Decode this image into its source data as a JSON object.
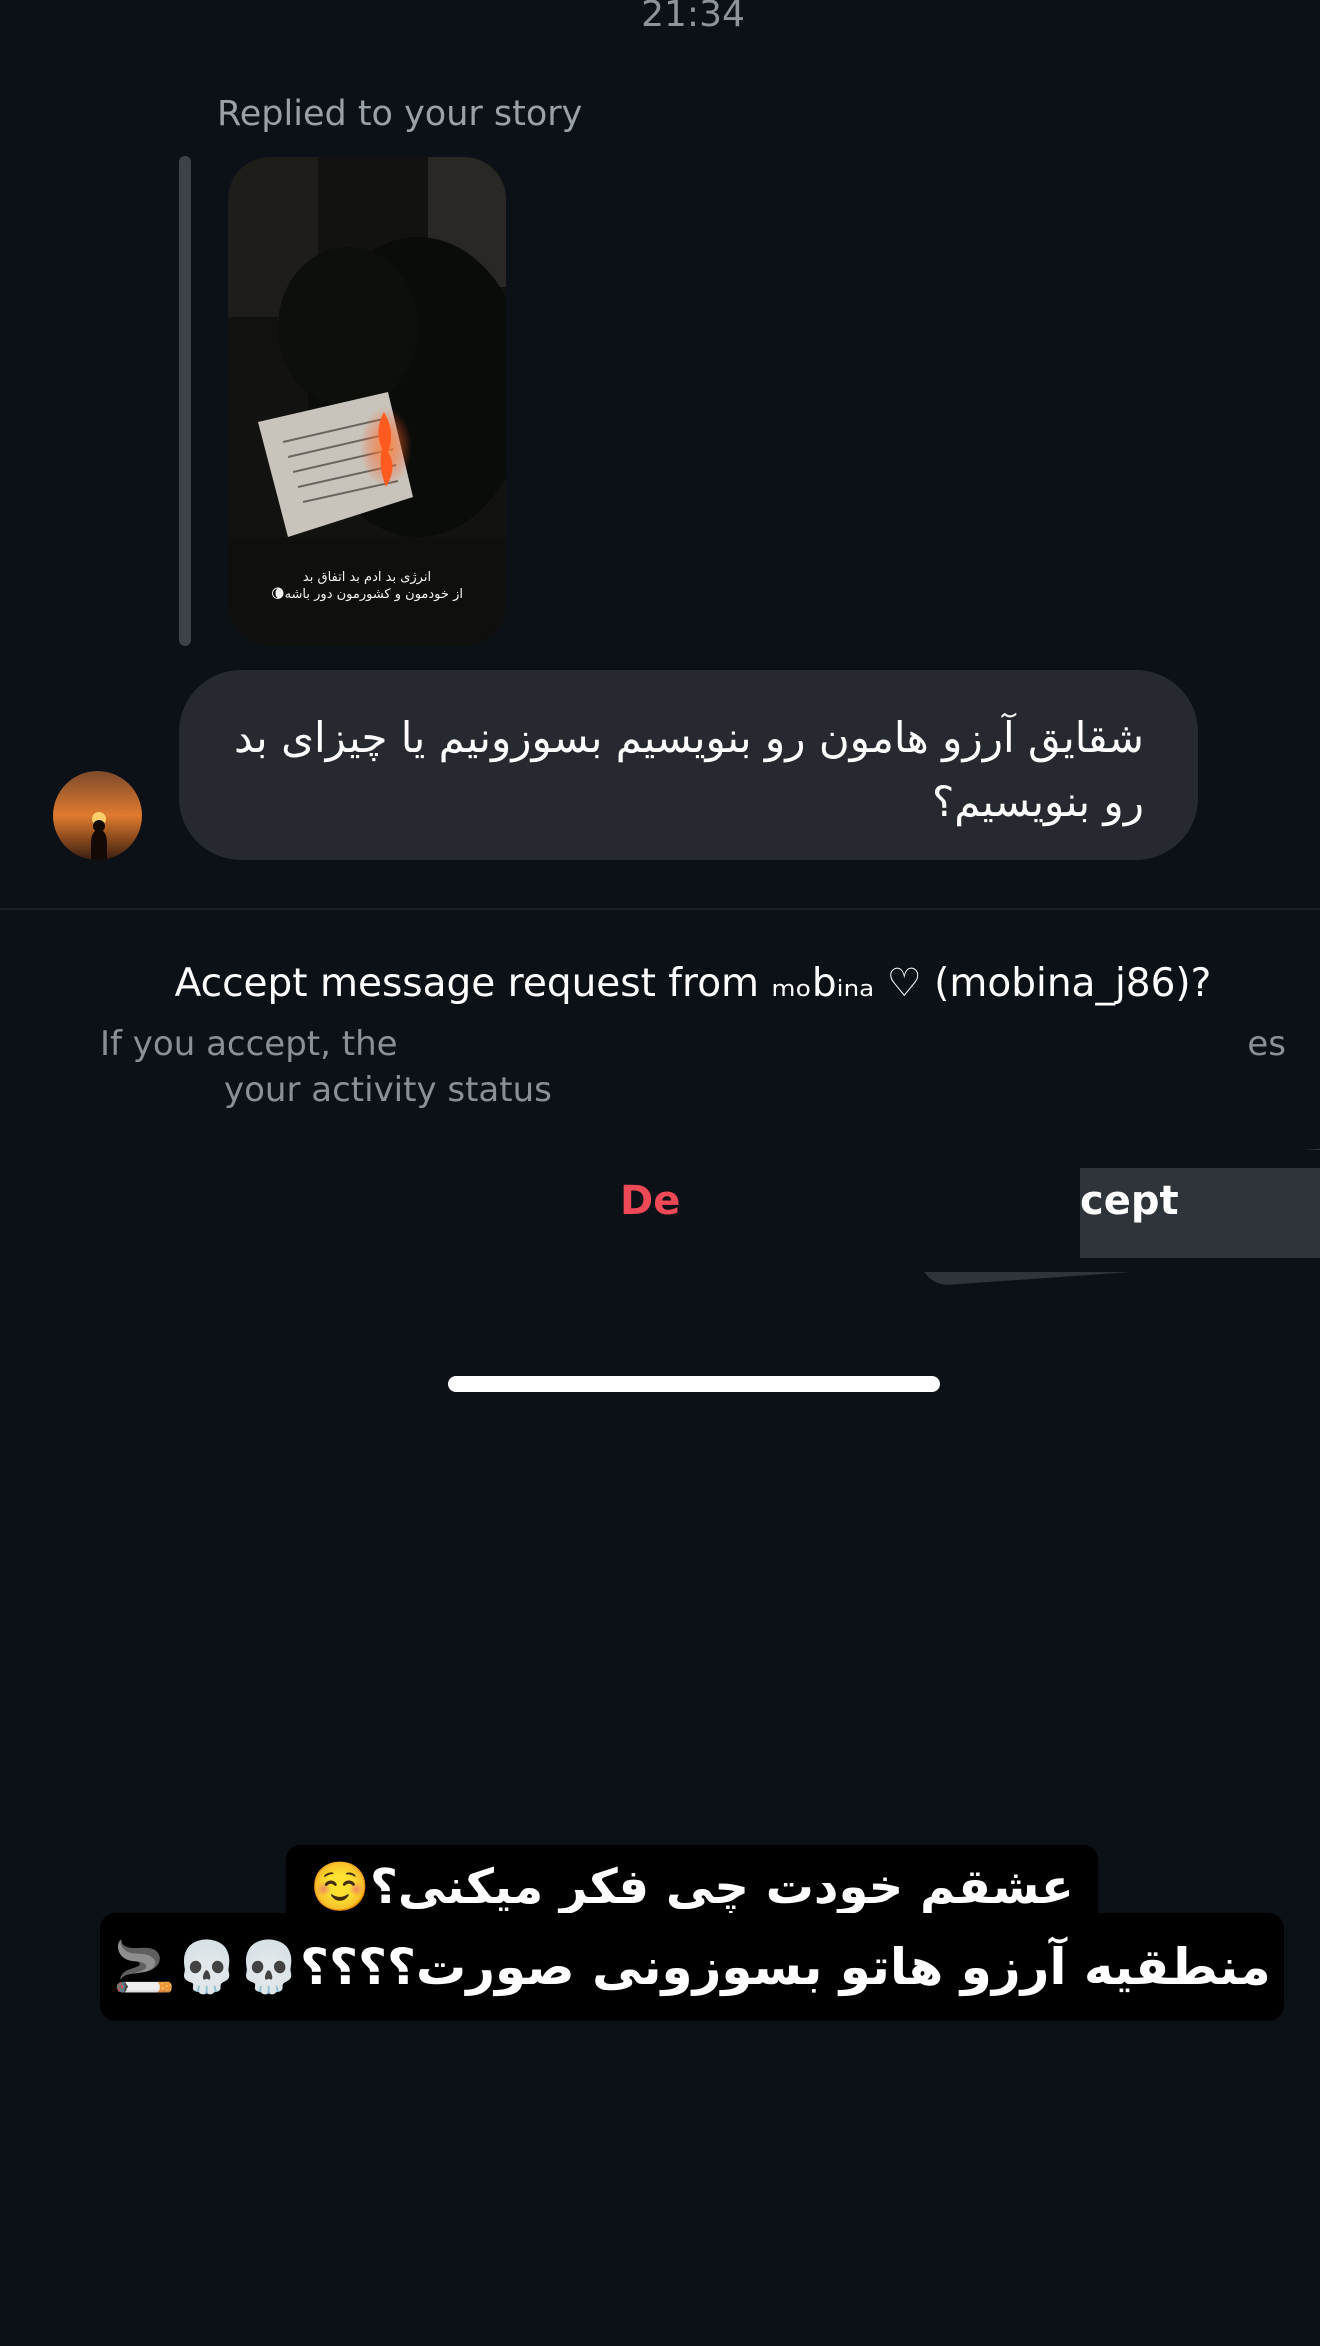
{
  "status": {
    "time": "21:34"
  },
  "story_reply": {
    "label": "Replied to your story",
    "story_caption_line1": "انرژی بد ادم بد اتفاق بد",
    "story_caption_line2": "از خودمون و کشورمون دور باشه🌘"
  },
  "message": {
    "text": "شقایق آرزو هامون رو بنویسیم بسوزونیم یا چیزای بد رو بنویسیم؟"
  },
  "request": {
    "title": "Accept message request from ₘₒbᵢₙₐ ♡ (mobina_j86)?",
    "desc_line1": "If you accept, the",
    "desc_line1_end": "es",
    "desc_line2": "your activity status"
  },
  "actions": {
    "delete_label": "Delete",
    "accept_label": "cept"
  },
  "overlay_caption": {
    "line1": "عشقم خودت چی فکر میکنی؟☺️",
    "line2": "منطقیه آرزو هاتو بسوزونی صورت؟؟؟؟💀💀🚬"
  },
  "colors": {
    "background": "#0c1017",
    "bubble": "#262a30",
    "delete": "#ed4956",
    "accept": "#2f343b"
  }
}
